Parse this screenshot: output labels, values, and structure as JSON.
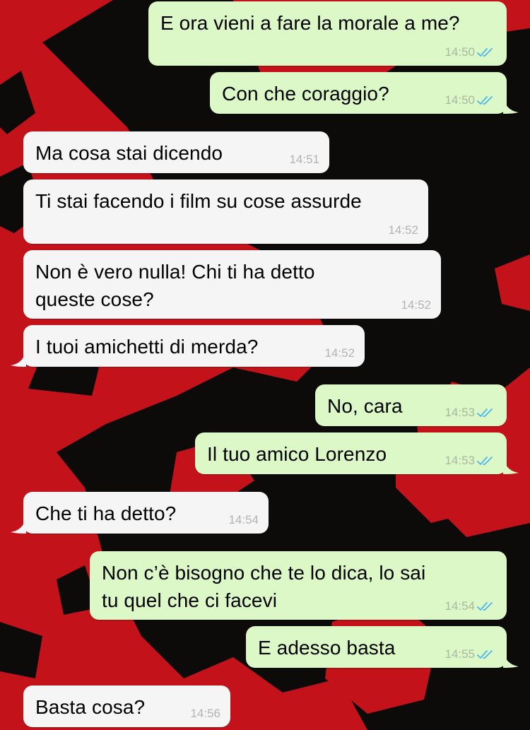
{
  "messages": [
    {
      "direction": "out",
      "text": "E ora vieni a fare la morale a me?",
      "time": "14:50",
      "status": "read"
    },
    {
      "direction": "out",
      "text": "Con che coraggio?",
      "time": "14:50",
      "status": "read"
    },
    {
      "direction": "in",
      "text": "Ma cosa stai dicendo",
      "time": "14:51"
    },
    {
      "direction": "in",
      "text": "Ti stai facendo i film su cose assurde",
      "time": "14:52"
    },
    {
      "direction": "in",
      "text": "Non è vero nulla! Chi ti ha detto\nqueste cose?",
      "time": "14:52"
    },
    {
      "direction": "in",
      "text": "I tuoi amichetti di merda?",
      "time": "14:52"
    },
    {
      "direction": "out",
      "text": "No, cara",
      "time": "14:53",
      "status": "read"
    },
    {
      "direction": "out",
      "text": "Il tuo amico Lorenzo",
      "time": "14:53",
      "status": "read"
    },
    {
      "direction": "in",
      "text": "Che ti ha detto?",
      "time": "14:54"
    },
    {
      "direction": "out",
      "text": "Non c’è bisogno che te lo dica, lo sai\ntu quel che ci facevi",
      "time": "14:54",
      "status": "read"
    },
    {
      "direction": "out",
      "text": "E adesso basta",
      "time": "14:55",
      "status": "read"
    },
    {
      "direction": "in",
      "text": "Basta cosa?",
      "time": "14:56"
    }
  ],
  "colors": {
    "outgoing_bubble": "#dcf8c6",
    "incoming_bubble": "#f5f5f5",
    "read_ticks": "#4fb6ec",
    "timestamp": "#b3b3b3",
    "wallpaper_red": "#c4121a",
    "wallpaper_dark": "#0d0a0a"
  },
  "icons": {
    "status_read": "double-check-icon"
  }
}
